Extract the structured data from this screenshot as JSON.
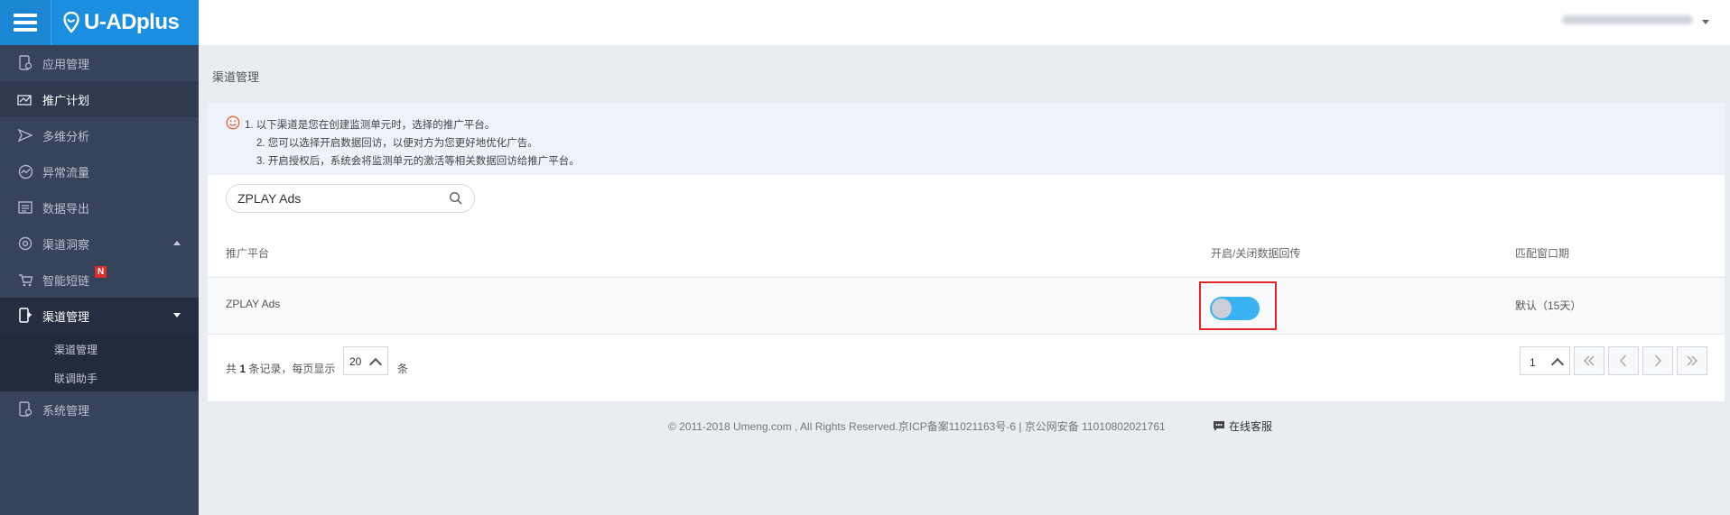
{
  "app": {
    "name": "U-ADplus"
  },
  "sidebar": {
    "items": [
      {
        "label": "应用管理",
        "icon": "app-phone-icon"
      },
      {
        "label": "推广计划",
        "icon": "campaign-icon"
      },
      {
        "label": "多维分析",
        "icon": "send-icon"
      },
      {
        "label": "异常流量",
        "icon": "trend-icon"
      },
      {
        "label": "数据导出",
        "icon": "export-icon"
      },
      {
        "label": "渠道洞察",
        "icon": "insight-icon"
      },
      {
        "label": "智能短链",
        "icon": "cart-icon",
        "badge": "N"
      },
      {
        "label": "渠道管理",
        "icon": "channel-icon"
      },
      {
        "label": "系统管理",
        "icon": "settings-phone-icon"
      }
    ],
    "submenu": [
      "渠道管理",
      "联调助手"
    ]
  },
  "breadcrumb": "渠道管理",
  "notice": {
    "lines": [
      "1. 以下渠道是您在创建监测单元时，选择的推广平台。",
      "2. 您可以选择开启数据回访，以便对方为您更好地优化广告。",
      "3. 开启授权后，系统会将监测单元的激活等相关数据回访给推广平台。"
    ]
  },
  "search": {
    "value": "ZPLAY Ads"
  },
  "table": {
    "headers": [
      "推广平台",
      "开启/关闭数据回传",
      "匹配窗口期"
    ],
    "rows": [
      {
        "platform": "ZPLAY Ads",
        "data_return_enabled": true,
        "window": "默认（15天）"
      }
    ]
  },
  "pagination": {
    "prefix": "共",
    "total": "1",
    "middle": "条记录，每页显示",
    "page_size": "20",
    "suffix": "条",
    "current_page": "1"
  },
  "footer": {
    "copyright": "© 2011-2018 Umeng.com , All Rights Reserved.京ICP备案11021163号-6 | 京公网安备 11010802021761",
    "online_service": "在线客服"
  },
  "colors": {
    "sidebar": "#37435a",
    "brand": "#1c8ee0",
    "toggle_on": "#3ab3f2",
    "highlight": "#e3262a"
  }
}
